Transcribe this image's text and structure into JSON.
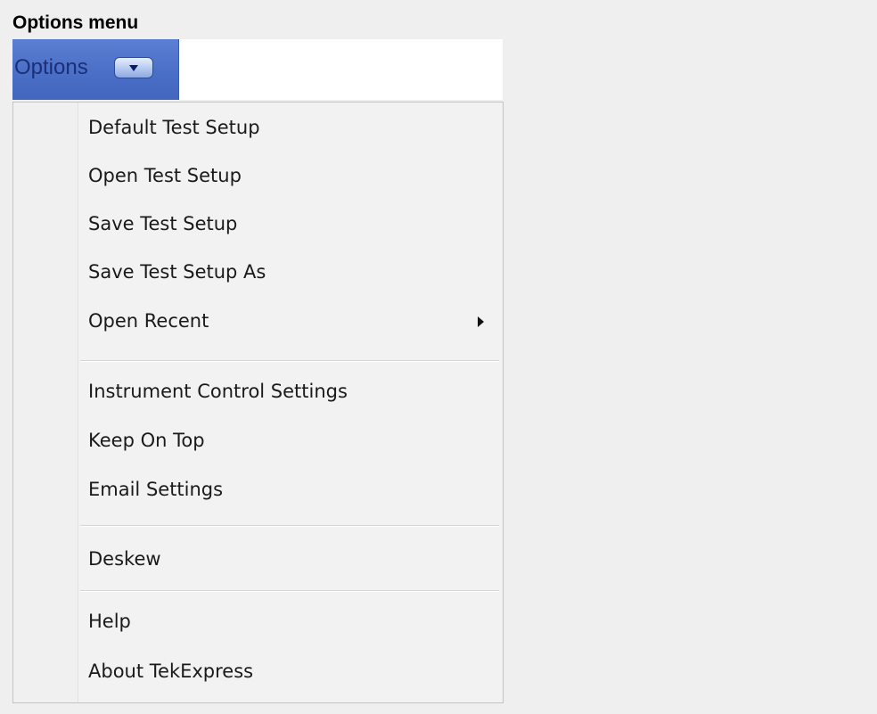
{
  "caption": "Options menu",
  "menubar": {
    "options_label": "Options"
  },
  "menu": {
    "items": [
      {
        "label": "Default Test Setup"
      },
      {
        "label": "Open Test Setup"
      },
      {
        "label": "Save Test Setup"
      },
      {
        "label": "Save Test Setup As"
      },
      {
        "label": "Open Recent"
      },
      {
        "label": "Instrument Control Settings"
      },
      {
        "label": "Keep On Top"
      },
      {
        "label": "Email Settings"
      },
      {
        "label": "Deskew"
      },
      {
        "label": "Help"
      },
      {
        "label": "About TekExpress"
      }
    ]
  },
  "colors": {
    "background": "#efefef",
    "options_button": "#4a6fc6",
    "options_text": "#1a2f78",
    "menu_bg": "#f2f2f2",
    "menu_border": "#c4c4c4"
  },
  "icons": {
    "dropdown": "chevron-down-icon",
    "submenu": "chevron-right-icon"
  }
}
